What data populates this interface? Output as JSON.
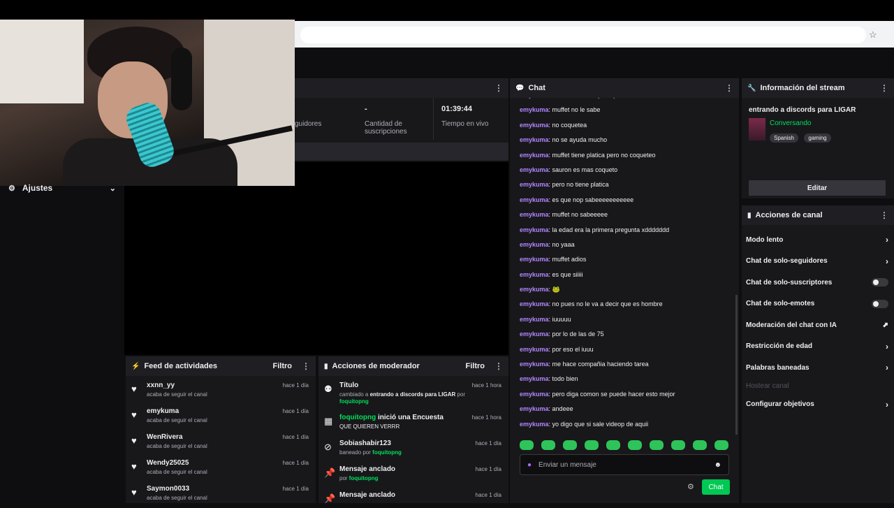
{
  "browser": {
    "star": "☆"
  },
  "settings": {
    "label": "Ajustes"
  },
  "stats": {
    "followers_label": "guidores",
    "subs_value": "-",
    "subs_label_1": "Cantidad de",
    "subs_label_2": "suscripciones",
    "live_value": "01:39:44",
    "live_label": "Tiempo en vivo"
  },
  "activity_feed": {
    "title": "Feed de actividades",
    "filter": "Filtro",
    "items": [
      {
        "name": "xxnn_yy",
        "sub": "acaba de seguir el canal",
        "time": "hace 1 día"
      },
      {
        "name": "emykuma",
        "sub": "acaba de seguir el canal",
        "time": "hace 1 día"
      },
      {
        "name": "WenRivera",
        "sub": "acaba de seguir el canal",
        "time": "hace 1 día"
      },
      {
        "name": "Wendy25025",
        "sub": "acaba de seguir el canal",
        "time": "hace 1 día"
      },
      {
        "name": "Saymon0033",
        "sub": "acaba de seguir el canal",
        "time": "hace 1 día"
      }
    ]
  },
  "mod_actions": {
    "title": "Acciones de moderador",
    "filter": "Filtro",
    "items": [
      {
        "title": "Título",
        "sub_pre": "cambiado a ",
        "sub_bold": "entrando a discords para LIGAR",
        "sub_mid": " por ",
        "sub_user": "foquitopng",
        "time": "hace 1 hora"
      },
      {
        "title_user": "foquitopng",
        "title": " inició una Encuesta",
        "sub_pre": "QUE QUIEREN VERRR",
        "time": "hace 1 hora"
      },
      {
        "title": "Sobiashabir123",
        "sub_pre": "baneado por ",
        "sub_user": "foquitopng",
        "time": "hace 1 día"
      },
      {
        "title": "Mensaje anclado",
        "sub_pre": "por ",
        "sub_user": "foquitopng",
        "time": "hace 1 día"
      },
      {
        "title": "Mensaje anclado",
        "sub_pre": "",
        "time": "hace 1 día"
      }
    ]
  },
  "chat": {
    "title": "Chat",
    "messages": [
      {
        "user": "emykuma",
        "text": "se una chica coqueta pero leve"
      },
      {
        "user": "emykuma",
        "text": "muffet no le sabe"
      },
      {
        "user": "emykuma",
        "text": "no coquetea"
      },
      {
        "user": "emykuma",
        "text": "no se ayuda mucho"
      },
      {
        "user": "emykuma",
        "text": "muffet tiene platica pero no coqueteo"
      },
      {
        "user": "emykuma",
        "text": "sauron es mas coqueto"
      },
      {
        "user": "emykuma",
        "text": "pero no tiene platica"
      },
      {
        "user": "emykuma",
        "text": "es que nop sabeeeeeeeeeee"
      },
      {
        "user": "emykuma",
        "text": "muffet no sabeeeee"
      },
      {
        "user": "emykuma",
        "text": "la edad era la primera pregunta xddddddd"
      },
      {
        "user": "emykuma",
        "text": "no yaaa"
      },
      {
        "user": "emykuma",
        "text": "muffet adios"
      },
      {
        "user": "emykuma",
        "text": "es que siiiii"
      },
      {
        "user": "emykuma",
        "text": "🐸"
      },
      {
        "user": "emykuma",
        "text": "no pues no le va a decir que es hombre"
      },
      {
        "user": "emykuma",
        "text": "iuuuuu"
      },
      {
        "user": "emykuma",
        "text": "por lo de las de 75"
      },
      {
        "user": "emykuma",
        "text": "por eso el iuuu"
      },
      {
        "user": "emykuma",
        "text": "me hace compañia haciendo tarea"
      },
      {
        "user": "emykuma",
        "text": "todo bien"
      },
      {
        "user": "emykuma",
        "text": "pero diga comon se puede hacer esto mejor"
      },
      {
        "user": "emykuma",
        "text": "andeee"
      },
      {
        "user": "emykuma",
        "text": "yo digo que si sale videop de aquii"
      }
    ],
    "placeholder": "Enviar un mensaje",
    "send_label": "Chat"
  },
  "stream_info": {
    "title": "Información del stream",
    "stream_title": "entrando a discords para LIGAR",
    "category": "Conversando",
    "tags": [
      "Spanish",
      "gaming"
    ],
    "edit_label": "Editar"
  },
  "channel_actions": {
    "title": "Acciones de canal",
    "items": [
      {
        "label": "Modo lento"
      },
      {
        "label": "Chat de solo-seguidores"
      },
      {
        "label": "Chat de solo-suscriptores"
      },
      {
        "label": "Chat de solo-emotes"
      },
      {
        "label": "Moderación del chat con IA"
      },
      {
        "label": "Restricción de edad"
      },
      {
        "label": "Palabras baneadas"
      },
      {
        "label": "Hostear canal"
      },
      {
        "label": "Configurar objetivos"
      }
    ]
  }
}
